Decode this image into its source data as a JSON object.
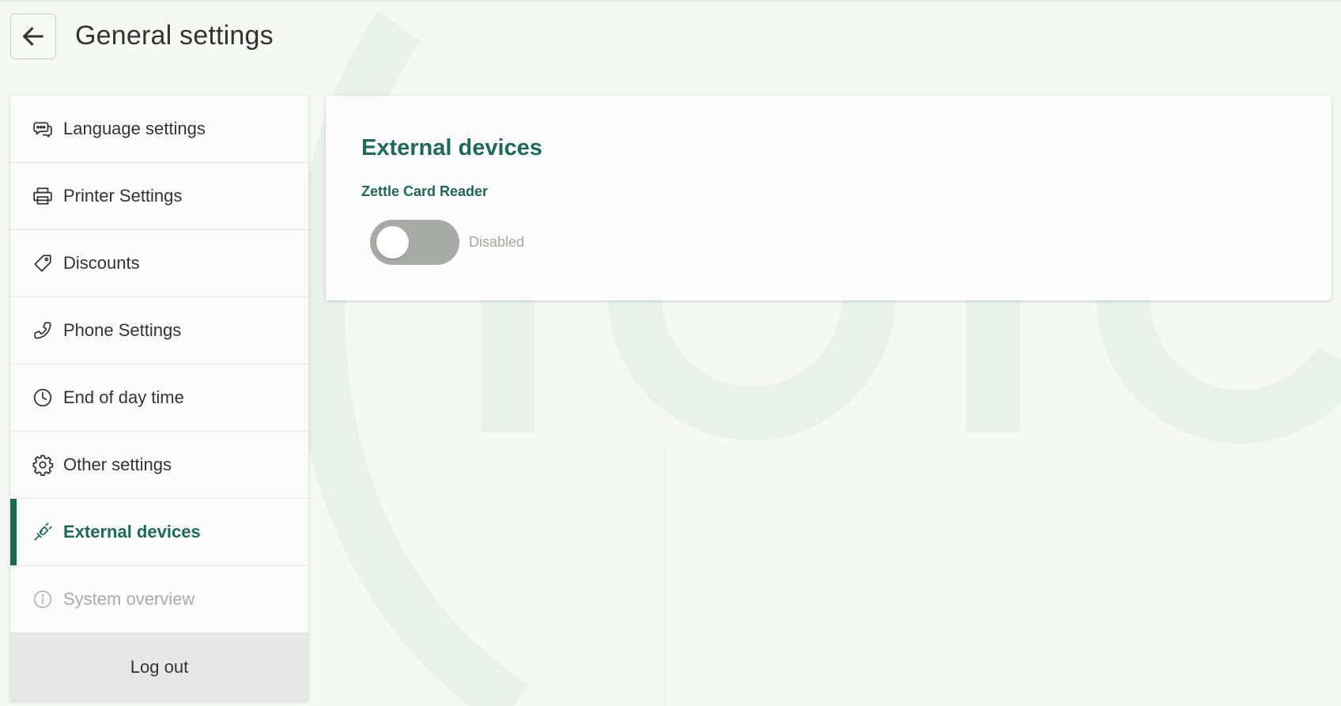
{
  "header": {
    "title": "General settings",
    "back_icon": "arrow-left-icon"
  },
  "sidebar": {
    "items": [
      {
        "label": "Language settings",
        "icon": "chat-bubbles-icon",
        "state": "normal"
      },
      {
        "label": "Printer Settings",
        "icon": "printer-icon",
        "state": "normal"
      },
      {
        "label": "Discounts",
        "icon": "tag-icon",
        "state": "normal"
      },
      {
        "label": "Phone Settings",
        "icon": "phone-icon",
        "state": "normal"
      },
      {
        "label": "End of day time",
        "icon": "clock-icon",
        "state": "normal"
      },
      {
        "label": "Other settings",
        "icon": "gear-icon",
        "state": "normal"
      },
      {
        "label": "External devices",
        "icon": "plug-icon",
        "state": "active"
      },
      {
        "label": "System overview",
        "icon": "info-icon",
        "state": "disabled"
      }
    ],
    "logout_label": "Log out"
  },
  "main": {
    "title": "External devices",
    "device": {
      "name": "Zettle Card Reader",
      "enabled": false,
      "status_label": "Disabled"
    }
  },
  "colors": {
    "accent": "#1d6a56",
    "background": "#f6f8f6",
    "toggle_off": "#a8aaa8",
    "disabled_text": "#a9aca9"
  }
}
